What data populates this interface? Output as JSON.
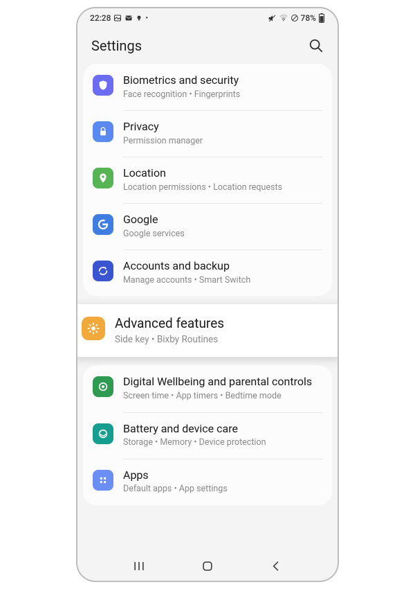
{
  "status": {
    "time": "22:28",
    "battery_text": "78%"
  },
  "header": {
    "title": "Settings"
  },
  "group1": [
    {
      "id": "biometrics",
      "title": "Biometrics and security",
      "sub": "Face recognition  •  Fingerprints",
      "color": "#6b6cf2",
      "icon": "shield"
    },
    {
      "id": "privacy",
      "title": "Privacy",
      "sub": "Permission manager",
      "color": "#5a8af0",
      "icon": "lock"
    },
    {
      "id": "location",
      "title": "Location",
      "sub": "Location permissions  •  Location requests",
      "color": "#57b455",
      "icon": "pin"
    },
    {
      "id": "google",
      "title": "Google",
      "sub": "Google services",
      "color": "#3f7de0",
      "icon": "google"
    },
    {
      "id": "accounts",
      "title": "Accounts and backup",
      "sub": "Manage accounts  •  Smart Switch",
      "color": "#3b55d1",
      "icon": "sync"
    }
  ],
  "highlight": {
    "id": "advanced",
    "title": "Advanced features",
    "sub": "Side key  •  Bixby Routines",
    "color": "#f2a93c",
    "icon": "gear"
  },
  "group2": [
    {
      "id": "wellbeing",
      "title": "Digital Wellbeing and parental controls",
      "sub": "Screen time  •  App timers  •  Bedtime mode",
      "color": "#2f9a52",
      "icon": "circle"
    },
    {
      "id": "battery",
      "title": "Battery and device care",
      "sub": "Storage  •  Memory  •  Device protection",
      "color": "#159d8f",
      "icon": "care"
    },
    {
      "id": "apps",
      "title": "Apps",
      "sub": "Default apps  •  App settings",
      "color": "#6b8ef5",
      "icon": "dots"
    }
  ]
}
